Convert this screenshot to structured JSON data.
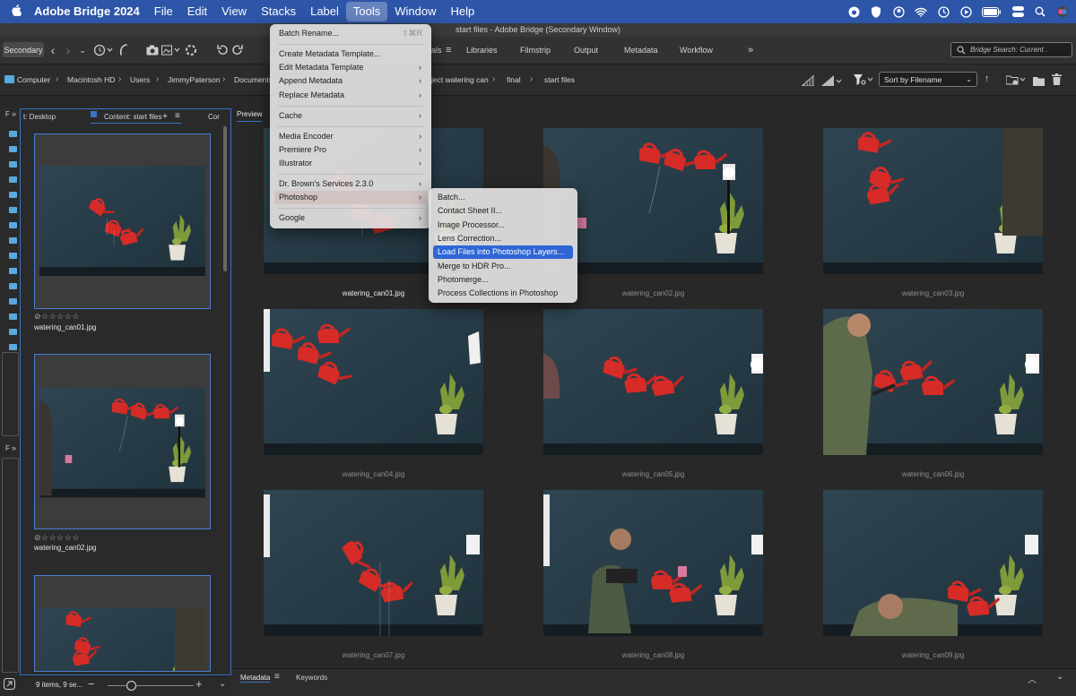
{
  "menubar": {
    "app_name": "Adobe Bridge 2024",
    "items": [
      "File",
      "Edit",
      "View",
      "Stacks",
      "Label",
      "Tools",
      "Window",
      "Help"
    ]
  },
  "window_title": "start files - Adobe Bridge (Secondary Window)",
  "toolbar": {
    "workspace_label": "Secondary",
    "workspaces_visible": [
      "ials",
      "Libraries",
      "Filmstrip",
      "Output",
      "Metadata",
      "Workflow"
    ],
    "search_placeholder": "Bridge Search: Current ."
  },
  "pathbar": {
    "crumbs": [
      "Computer",
      "Macintosh HD",
      "Users",
      "JimmyPaterson",
      "Documents",
      "ject watering can",
      "final",
      "start files"
    ],
    "sort_label": "Sort by Filename"
  },
  "content_panel": {
    "tab_left": "t: Desktop",
    "tab_main": "Content: start files",
    "tab_right": "Cor",
    "items": [
      {
        "name": "watering_can01.jpg",
        "stars": "☆☆☆☆☆"
      },
      {
        "name": "watering_can02.jpg",
        "stars": "☆☆☆☆☆"
      }
    ],
    "status": "9 items, 9 se..."
  },
  "preview": {
    "tab": "Preview",
    "images": [
      "watering_can01.jpg",
      "watering_can02.jpg",
      "watering_can03.jpg",
      "watering_can04.jpg",
      "watering_can05.jpg",
      "watering_can06.jpg",
      "watering_can07.jpg",
      "watering_can08.jpg",
      "watering_can09.jpg"
    ],
    "selected_index": 0
  },
  "metadata_bar": {
    "tabs": [
      "Metadata",
      "Keywords"
    ]
  },
  "tools_menu": {
    "items": [
      {
        "label": "Batch Rename...",
        "shortcut": "⇧⌘R"
      },
      {
        "label": "Create Metadata Template..."
      },
      {
        "label": "Edit Metadata Template"
      },
      {
        "label": "Append Metadata"
      },
      {
        "label": "Replace Metadata"
      },
      {
        "label": "Cache"
      },
      {
        "label": "Media Encoder"
      },
      {
        "label": "Premiere Pro"
      },
      {
        "label": "Illustrator"
      },
      {
        "label": "Dr. Brown's Services 2.3.0"
      },
      {
        "label": "Photoshop"
      },
      {
        "label": "Google"
      }
    ]
  },
  "photoshop_submenu": {
    "items": [
      "Batch...",
      "Contact Sheet II...",
      "Image Processor...",
      "Lens Correction...",
      "Load Files into Photoshop Layers...",
      "Merge to HDR Pro...",
      "Photomerge...",
      "Process Collections in Photoshop"
    ],
    "selected_index": 4
  }
}
